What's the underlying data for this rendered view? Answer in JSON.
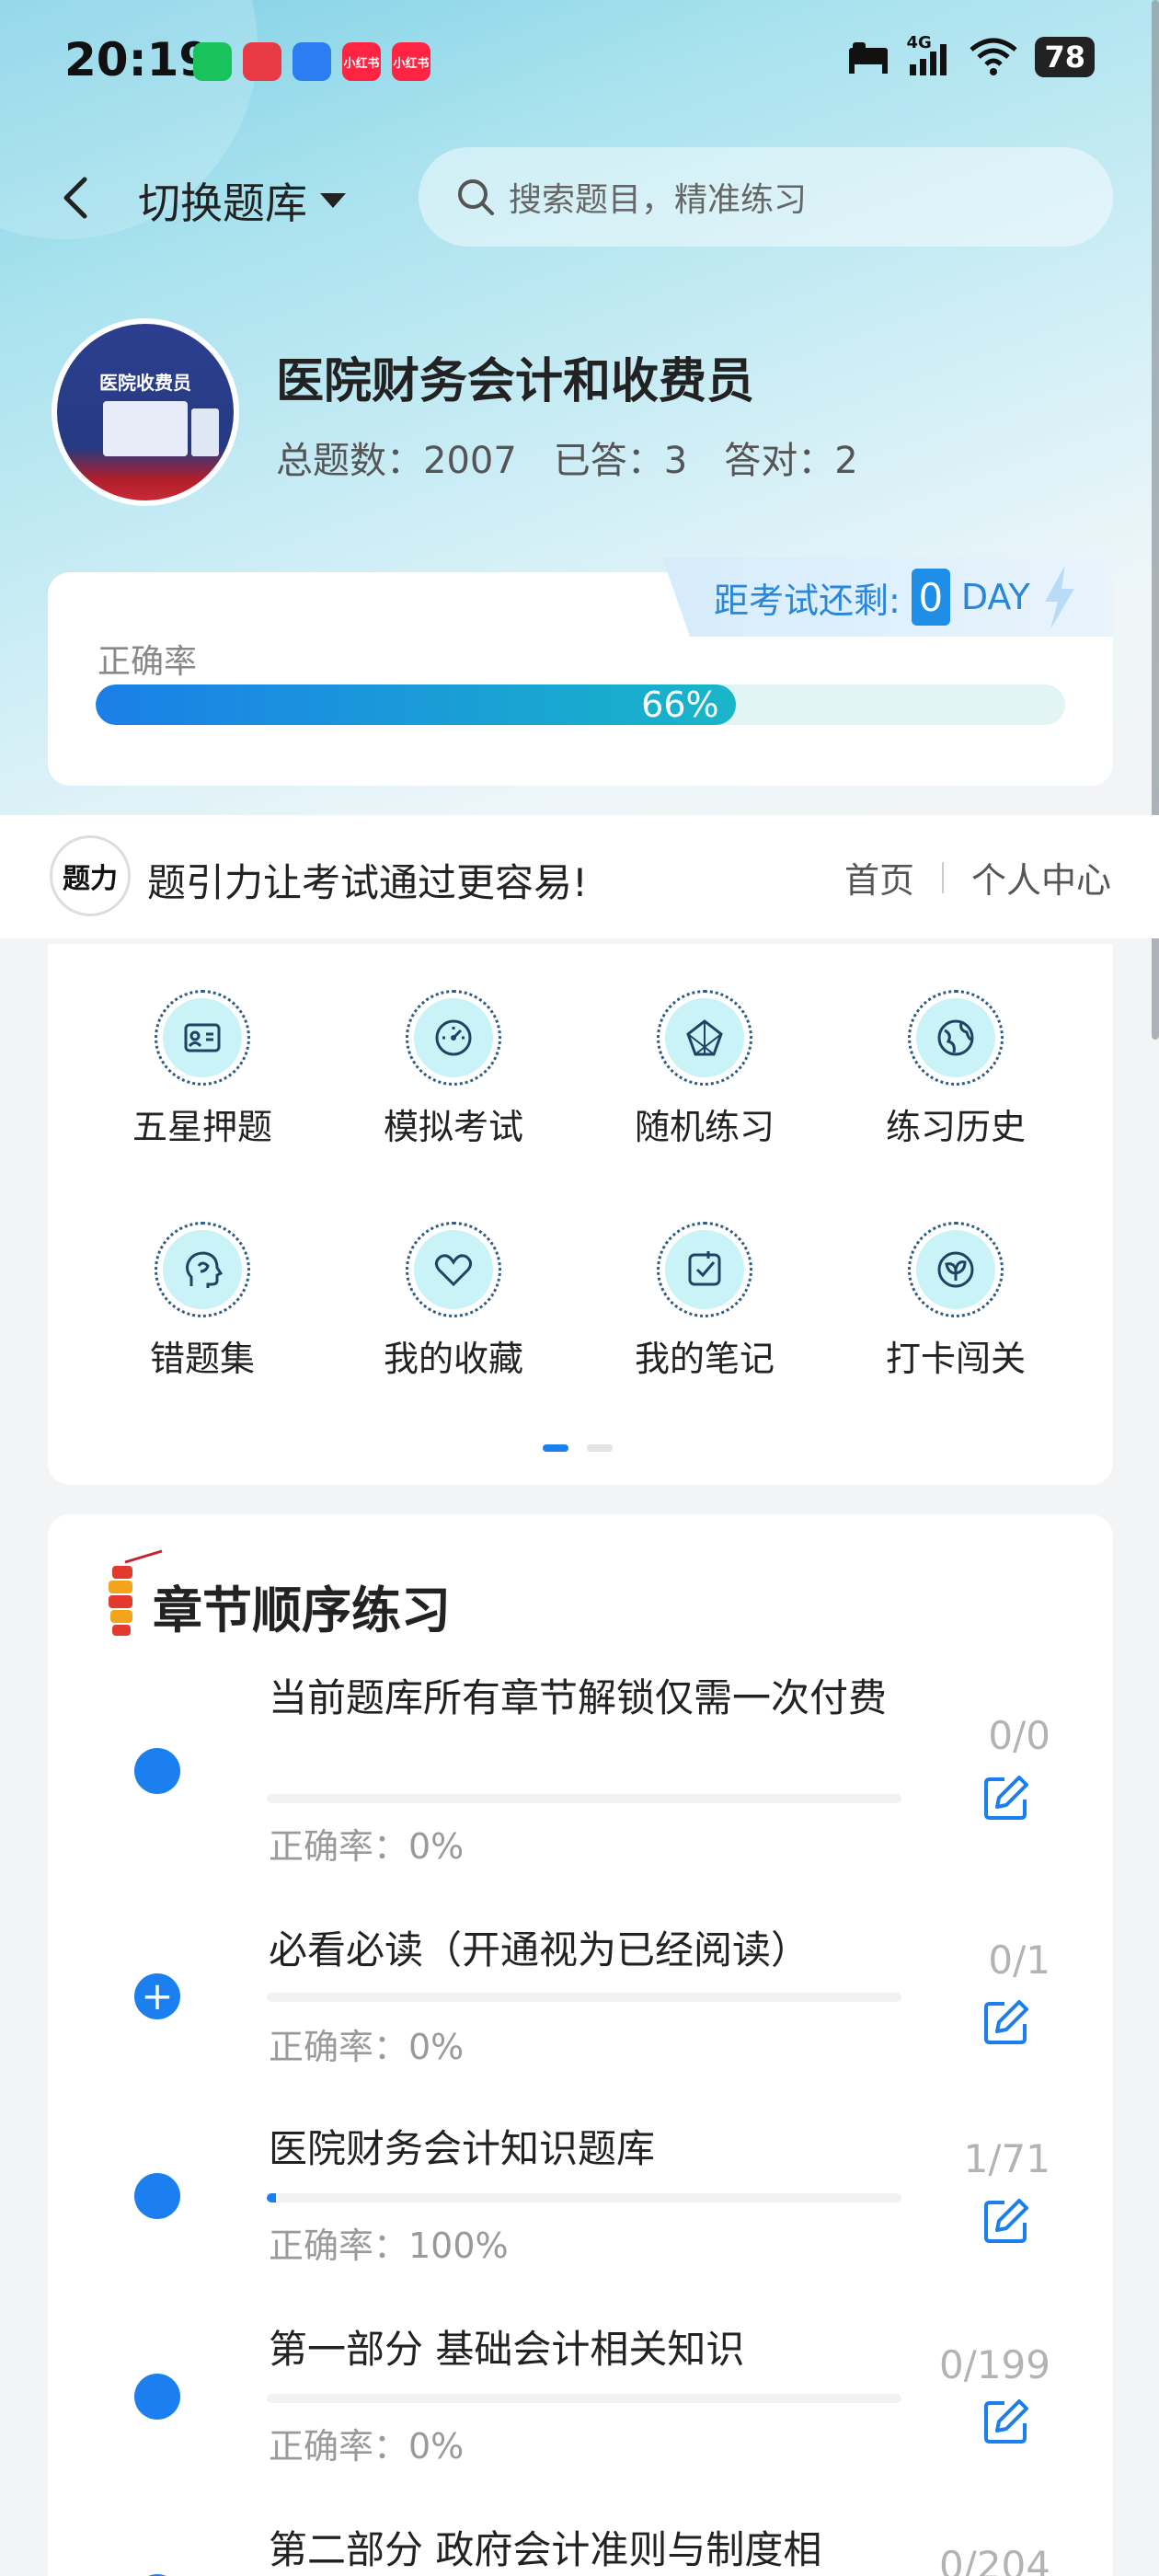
{
  "status_bar": {
    "time": "20:19",
    "network": "4G",
    "battery": "78",
    "app_icons": [
      {
        "name": "wechat-icon",
        "color": "#19c35b",
        "text": ""
      },
      {
        "name": "app-icon-red",
        "color": "#e83a45",
        "text": ""
      },
      {
        "name": "app-icon-blue",
        "color": "#2d7df2",
        "text": ""
      },
      {
        "name": "xiaohongshu-icon",
        "color": "#ff2442",
        "text": "小红书"
      },
      {
        "name": "xiaohongshu-icon-2",
        "color": "#ff2442",
        "text": "小红书"
      }
    ]
  },
  "nav": {
    "switch_label": "切换题库",
    "search_placeholder": "搜索题目，精准练习"
  },
  "course": {
    "avatar_text": "医院收费员",
    "title": "医院财务会计和收费员",
    "total_label": "总题数：2007",
    "answered_label": "已答：3",
    "correct_label": "答对：2"
  },
  "accuracy": {
    "label": "正确率",
    "percent_text": "66%",
    "fraction": 0.66,
    "countdown_label": "距考试还剩:",
    "countdown_days": "0",
    "countdown_unit": "DAY"
  },
  "slogan": {
    "logo_text": "题力",
    "text": "题引力让考试通过更容易!",
    "nav_home": "首页",
    "nav_profile": "个人中心"
  },
  "features": [
    {
      "label": "五星押题",
      "icon": "id-card-icon"
    },
    {
      "label": "模拟考试",
      "icon": "gauge-icon"
    },
    {
      "label": "随机练习",
      "icon": "random-icon"
    },
    {
      "label": "练习历史",
      "icon": "globe-icon"
    },
    {
      "label": "错题集",
      "icon": "head-icon"
    },
    {
      "label": "我的收藏",
      "icon": "heart-icon"
    },
    {
      "label": "我的笔记",
      "icon": "note-check-icon"
    },
    {
      "label": "打卡闯关",
      "icon": "leaf-icon"
    }
  ],
  "chapters": {
    "title": "章节顺序练习",
    "items": [
      {
        "name": "当前题库所有章节解锁仅需一次付费",
        "acc": "正确率：0%",
        "count": "0/0",
        "progress": 0,
        "dot": ""
      },
      {
        "name": "必看必读（开通视为已经阅读）",
        "acc": "正确率：0%",
        "count": "0/1",
        "progress": 0,
        "dot": "+"
      },
      {
        "name": "医院财务会计知识题库",
        "acc": "正确率：100%",
        "count": "1/71",
        "progress": 0.014,
        "dot": ""
      },
      {
        "name": "第一部分 基础会计相关知识",
        "acc": "正确率：0%",
        "count": "0/199",
        "progress": 0,
        "dot": ""
      },
      {
        "name": "第二部分 政府会计准则与制度相",
        "acc": "",
        "count": "0/204",
        "progress": 0,
        "dot": ""
      }
    ]
  }
}
